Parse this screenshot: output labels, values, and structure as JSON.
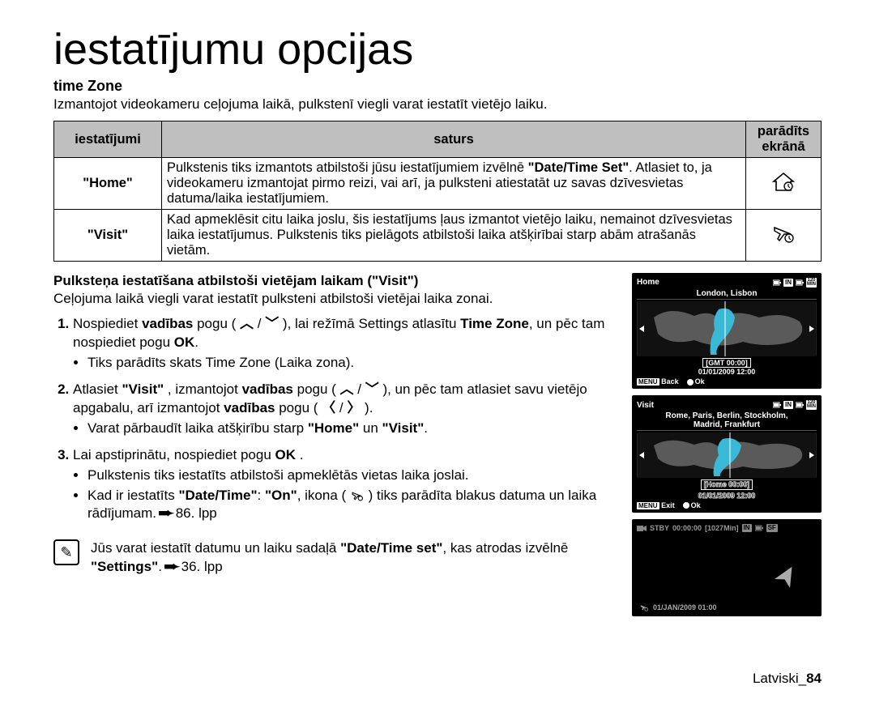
{
  "title": "iestatījumu opcijas",
  "section_heading": "time Zone",
  "intro": "Izmantojot videokameru ceļojuma laikā, pulkstenī viegli varat iestatīt vietējo laiku.",
  "table": {
    "headers": {
      "col1": "iestatījumi",
      "col2": "saturs",
      "col3_a": "parādīts",
      "col3_b": "ekrānā"
    },
    "rows": [
      {
        "setting": "\"Home\"",
        "content_a": "Pulkstenis tiks izmantots atbilstoši jūsu iestatījumiem izvēlnē ",
        "content_b": "\"Date/Time Set\"",
        "content_c": ". Atlasiet to, ja videokameru izmantojat pirmo reizi, vai arī, ja pulksteni atiestatāt uz savas dzīvesvietas datuma/laika iestatījumiem.",
        "icon": "home-clock-icon"
      },
      {
        "setting": "\"Visit\"",
        "content_a": "Kad apmeklēsit citu laika joslu, šis iestatījums ļaus izmantot vietējo laiku, nemainot dzīvesvietas laika iestatījumus. Pulkstenis tiks pielāgots atbilstoši laika atšķirībai starp abām atrašanās vietām.",
        "content_b": "",
        "content_c": "",
        "icon": "plane-clock-icon"
      }
    ]
  },
  "sub_heading": "Pulksteņa iestatīšana atbilstoši vietējam laikam (\"Visit\")",
  "sub_intro": "Ceļojuma laikā viegli varat iestatīt pulksteni atbilstoši vietējai laika zonai.",
  "steps": {
    "s1_a": "Nospiediet ",
    "s1_b": "vadības",
    "s1_c": " pogu ( ",
    "s1_d": " / ",
    "s1_e": " ), lai režīmā Settings atlasītu ",
    "s1_f": "Time Zone",
    "s1_g": ", un pēc tam nospiediet pogu ",
    "s1_h": "OK",
    "s1_i": ".",
    "s1_sub1": "Tiks parādīts skats Time Zone (Laika zona).",
    "s2_a": "Atlasiet ",
    "s2_b": "\"Visit\"",
    "s2_c": " , izmantojot ",
    "s2_d": "vadības",
    "s2_e": " pogu ( ",
    "s2_f": " / ",
    "s2_g": " ), un pēc tam atlasiet savu vietējo apgabalu, arī izmantojot ",
    "s2_h": "vadības",
    "s2_i": " pogu ( ",
    "s2_j": " / ",
    "s2_k": " ).",
    "s2_sub1_a": "Varat pārbaudīt laika atšķirību starp ",
    "s2_sub1_b": "\"Home\"",
    "s2_sub1_c": " un ",
    "s2_sub1_d": "\"Visit\"",
    "s2_sub1_e": ".",
    "s3_a": "Lai apstiprinātu, nospiediet pogu ",
    "s3_b": "OK",
    "s3_c": " .",
    "s3_sub1": "Pulkstenis tiks iestatīts atbilstoši apmeklētās vietas laika joslai.",
    "s3_sub2_a": "Kad ir iestatīts ",
    "s3_sub2_b": "\"Date/Time\"",
    "s3_sub2_c": ": ",
    "s3_sub2_d": "\"On\"",
    "s3_sub2_e": ", ikona ( ",
    "s3_sub2_f": " ) tiks parādīta blakus datuma un laika rādījumam. ",
    "s3_sub2_g": " 86. lpp"
  },
  "note": {
    "a": "Jūs varat iestatīt datumu un laiku sadaļā ",
    "b": "\"Date/Time set\"",
    "c": ", kas atrodas izvēlnē ",
    "d": "\"Settings\"",
    "e": ". ",
    "f": " 36. lpp"
  },
  "screens": {
    "home": {
      "label": "Home",
      "cities": "London, Lisbon",
      "gmt": "[GMT 00:00]",
      "date": "01/01/2009 12:00",
      "back": "Back",
      "ok": "Ok",
      "menu": "MENU"
    },
    "visit": {
      "label": "Visit",
      "cities_a": "Rome, Paris, Berlin, Stockholm,",
      "cities_b": "Madrid, Frankfurt",
      "gmt": "[Home 00:00]",
      "date": "01/01/2009 12:00",
      "exit": "Exit",
      "ok": "Ok",
      "menu": "MENU"
    },
    "stby": {
      "stby": "STBY",
      "time": "00:00:00",
      "remain": "[1027Min]",
      "date": "01/JAN/2009 01:00"
    },
    "badges": {
      "in": "IN",
      "min120": "120\nMIN"
    }
  },
  "footer": {
    "lang": "Latviski_",
    "page": "84"
  }
}
